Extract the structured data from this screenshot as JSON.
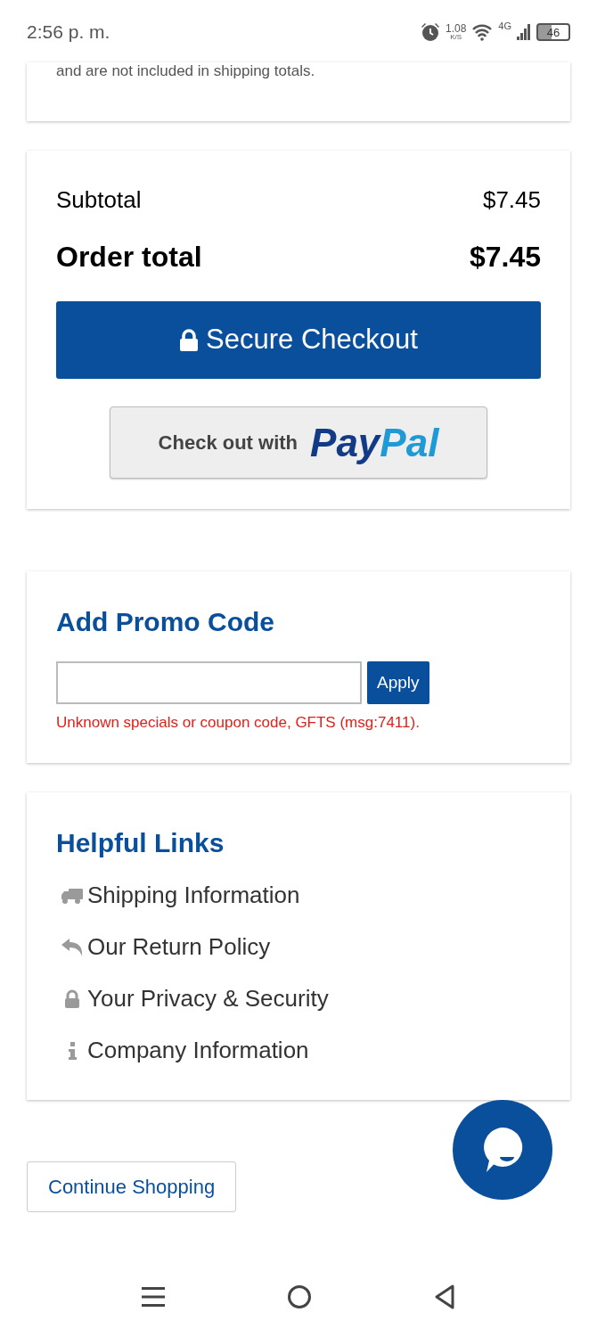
{
  "status_bar": {
    "time": "2:56 p. m.",
    "speed": "1.08",
    "speed_unit": "K/S",
    "network": "4G",
    "battery": "46"
  },
  "shipping_note": "and are not included in shipping totals.",
  "summary": {
    "rows": [
      {
        "kind": "subtotal",
        "label": "Subtotal",
        "value": "$7.45"
      },
      {
        "kind": "total",
        "label": "Order total",
        "value": "$7.45"
      }
    ],
    "checkout_button": "Secure Checkout",
    "paypal": {
      "prefix": "Check out with",
      "pay": "Pay",
      "pal": "Pal"
    }
  },
  "promo": {
    "title": "Add Promo Code",
    "apply_button": "Apply",
    "error": "Unknown specials or coupon code, GFTS (msg:7411)."
  },
  "helpful_links": {
    "title": "Helpful Links",
    "items": [
      {
        "kind": "truck",
        "label": "Shipping Information"
      },
      {
        "kind": "return",
        "label": "Our Return Policy"
      },
      {
        "kind": "lock",
        "label": "Your Privacy & Security"
      },
      {
        "kind": "info",
        "label": "Company Information"
      }
    ]
  },
  "continue_button": "Continue Shopping"
}
